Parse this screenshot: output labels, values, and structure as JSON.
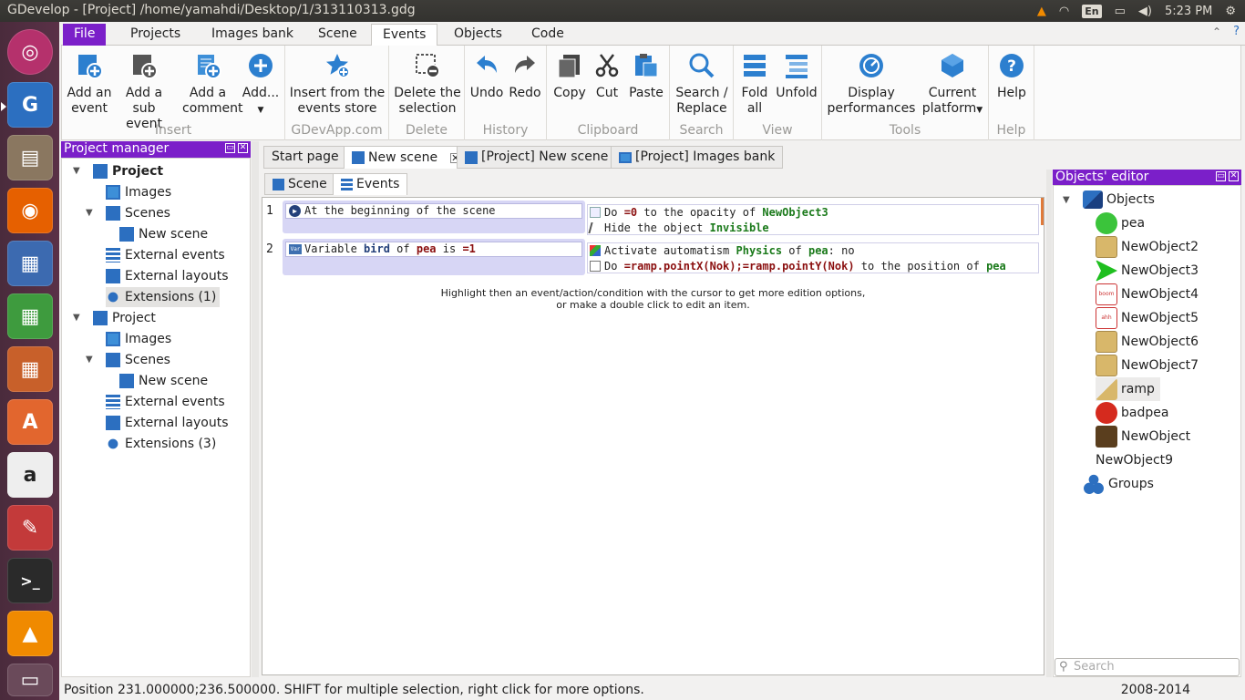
{
  "window": {
    "title": "GDevelop - [Project] /home/yamahdi/Desktop/1/313110313.gdg"
  },
  "tray": {
    "keyboard": "En",
    "clock": "5:23 PM"
  },
  "ribbon_tabs": [
    "File",
    "Projects",
    "Images bank",
    "Scene",
    "Events",
    "Objects",
    "Code"
  ],
  "ribbon": {
    "insert": {
      "label": "Insert",
      "add_event": "Add an event",
      "add_sub_event": "Add a sub event",
      "add_comment": "Add a comment",
      "add_more": "Add..."
    },
    "store": {
      "label": "GDevApp.com",
      "insert_store": "Insert from the events store"
    },
    "delete": {
      "label": "Delete",
      "delete_selection": "Delete the selection"
    },
    "history": {
      "label": "History",
      "undo": "Undo",
      "redo": "Redo"
    },
    "clipboard": {
      "label": "Clipboard",
      "copy": "Copy",
      "cut": "Cut",
      "paste": "Paste"
    },
    "search": {
      "label": "Search",
      "search_replace": "Search / Replace"
    },
    "view": {
      "label": "View",
      "fold_all": "Fold all",
      "unfold": "Unfold"
    },
    "tools": {
      "label": "Tools",
      "display_perf": "Display performances",
      "platform": "Current platform"
    },
    "help": {
      "label": "Help",
      "help": "Help"
    }
  },
  "project_manager": {
    "title": "Project manager",
    "tree": [
      {
        "label": "Project",
        "bold": true
      },
      {
        "label": "Images"
      },
      {
        "label": "Scenes"
      },
      {
        "label": "New scene"
      },
      {
        "label": "External events"
      },
      {
        "label": "External layouts"
      },
      {
        "label": "Extensions (1)"
      },
      {
        "label": "Project"
      },
      {
        "label": "Images"
      },
      {
        "label": "Scenes"
      },
      {
        "label": "New scene"
      },
      {
        "label": "External events"
      },
      {
        "label": "External layouts"
      },
      {
        "label": "Extensions (3)"
      }
    ]
  },
  "doc_tabs": [
    "Start page",
    "New scene",
    "[Project] New scene",
    "[Project] Images bank"
  ],
  "sub_tabs": [
    "Scene",
    "Events"
  ],
  "events": [
    {
      "number": "1",
      "condition": "At the beginning of the scene",
      "actions": [
        {
          "pre": "Do ",
          "val": "=0",
          "mid": " to the opacity of ",
          "obj": "NewObject3",
          "post": ""
        },
        {
          "pre": "Hide the object ",
          "val": "",
          "mid": "",
          "obj": "Invisible",
          "post": ""
        }
      ]
    },
    {
      "number": "2",
      "condition_pre": "Variable ",
      "condition_var": "bird",
      "condition_mid": " of ",
      "condition_obj": "pea",
      "condition_tail": " is ",
      "condition_val": "=1",
      "actions": [
        {
          "pre": "Activate automatism ",
          "val": "",
          "mid": "",
          "obj": "Physics",
          "post": " of ",
          "obj2": "pea",
          "post2": ": no"
        },
        {
          "pre": "Do ",
          "val": "=ramp.pointX(Nok);=ramp.pointY(Nok)",
          "mid": " to the position of ",
          "obj": "pea",
          "post": ""
        }
      ]
    }
  ],
  "hint": {
    "line1": "Highlight then an event/action/condition with the cursor to get more edition options,",
    "line2": "or make a double click to edit an item."
  },
  "objects_editor": {
    "title": "Objects' editor",
    "root": "Objects",
    "items": [
      "pea",
      "NewObject2",
      "NewObject3",
      "NewObject4",
      "NewObject5",
      "NewObject6",
      "NewObject7",
      "ramp",
      "badpea",
      "NewObject",
      "NewObject9"
    ],
    "groups": "Groups",
    "search_placeholder": "Search"
  },
  "status": {
    "text": "Position 231.000000;236.500000. SHIFT for multiple selection, right click for more options.",
    "years": "2008-2014"
  },
  "colors": {
    "accent": "#7b1fc9",
    "condition_bg": "#d7d6f5",
    "object_green": "#1b7a1b",
    "value_red": "#8b1010"
  }
}
